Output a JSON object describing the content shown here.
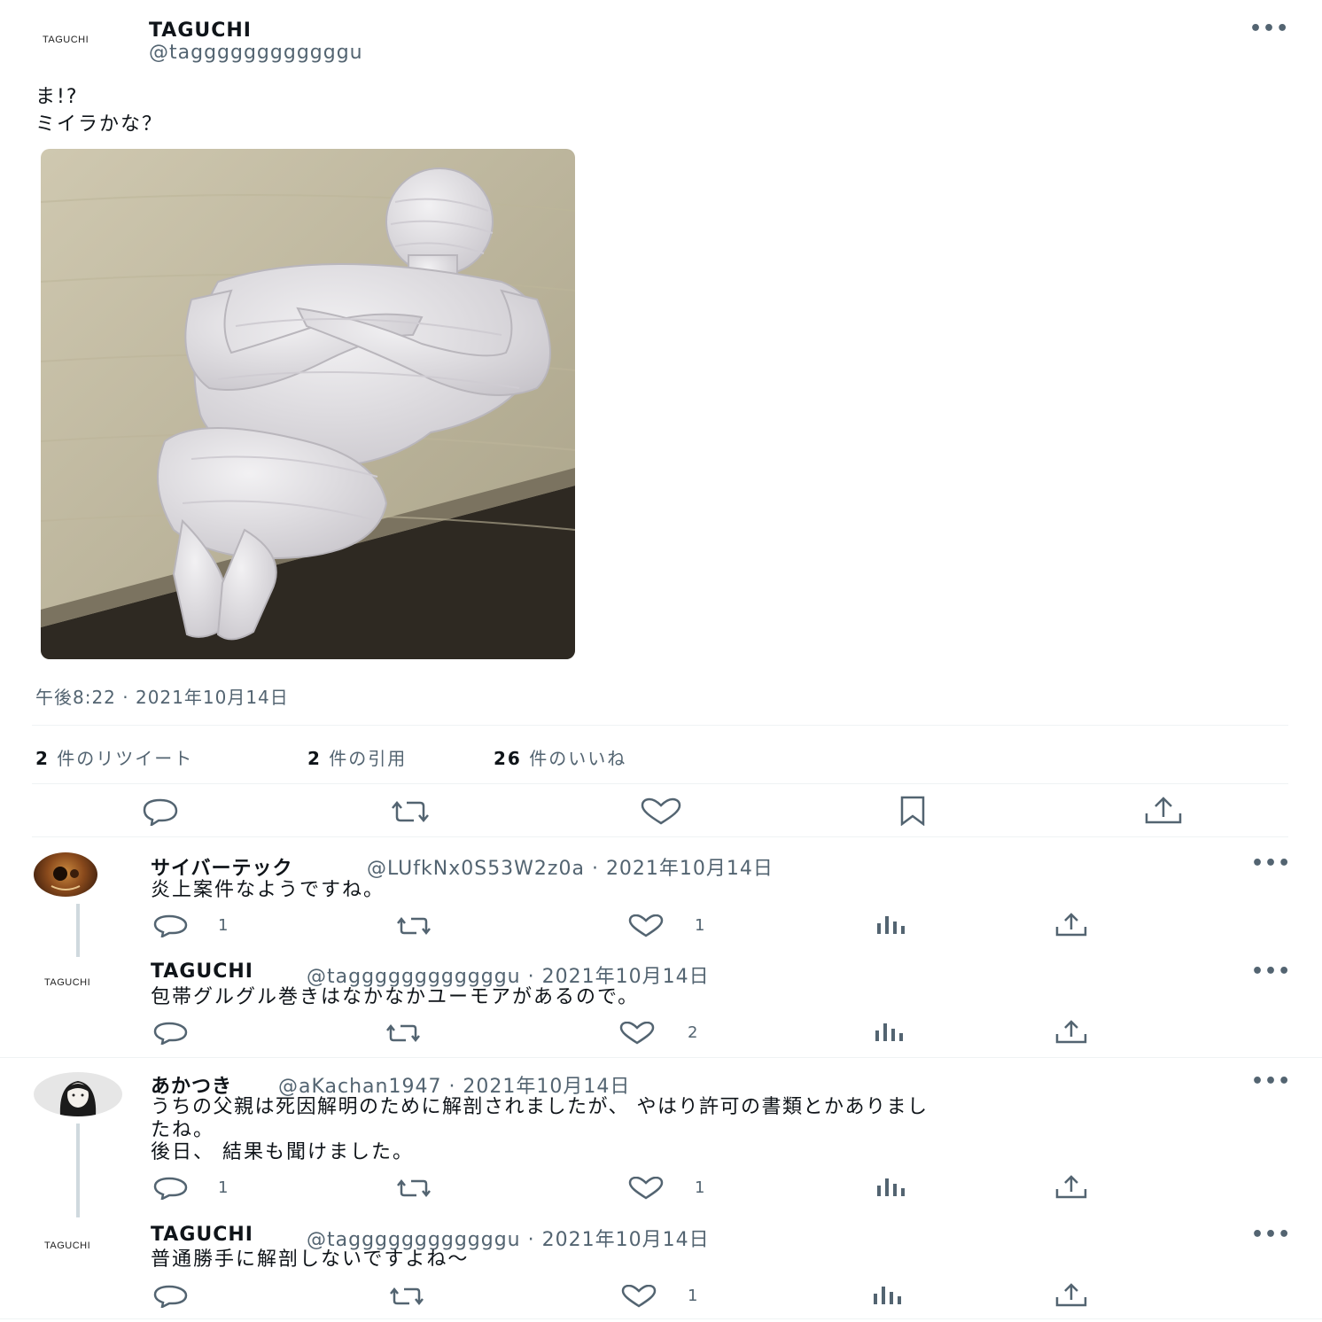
{
  "main_tweet": {
    "avatar_label": "TAGUCHI",
    "name": "TAGUCHI",
    "handle": "@taggggggggggggu",
    "more": "•••",
    "text_line1": "ま!?",
    "text_line2": "ミイラかな？",
    "timestamp": "午後8:22 · 2021年10月14日",
    "retweets_num": "2",
    "retweets_label": "件のリツイート",
    "quotes_num": "2",
    "quotes_label": "件の引用",
    "likes_num": "26",
    "likes_label": "件のいいね"
  },
  "replies": [
    {
      "name": "サイバーテック",
      "handle": "@LUfkNx0S53W2z0a · 2021年10月14日",
      "text_line1": "炎上案件なようですね。",
      "reply_count": "1",
      "like_count": "1",
      "more": "•••"
    },
    {
      "avatar_label": "TAGUCHI",
      "name": "TAGUCHI",
      "handle": "@taggggggggggggu · 2021年10月14日",
      "text_line1": "包帯グルグル巻きはなかなかユーモアがあるので。",
      "like_count": "2",
      "more": "•••"
    },
    {
      "name": "あかつき",
      "handle": "@aKachan1947 · 2021年10月14日",
      "text_line1": "うちの父親は死因解明のために解剖されましたが、 やはり許可の書類とかありまし",
      "text_line2": "たね。",
      "text_line3": "後日、 結果も聞けました。",
      "reply_count": "1",
      "like_count": "1",
      "more": "•••"
    },
    {
      "avatar_label": "TAGUCHI",
      "name": "TAGUCHI",
      "handle": "@taggggggggggggu · 2021年10月14日",
      "text_line1": "普通勝手に解剖しないですよね～",
      "like_count": "1",
      "more": "•••"
    }
  ],
  "colors": {
    "text": "#0f1419",
    "secondary": "#536471",
    "divider": "#eff3f4",
    "thread_line": "#cfd9de"
  }
}
